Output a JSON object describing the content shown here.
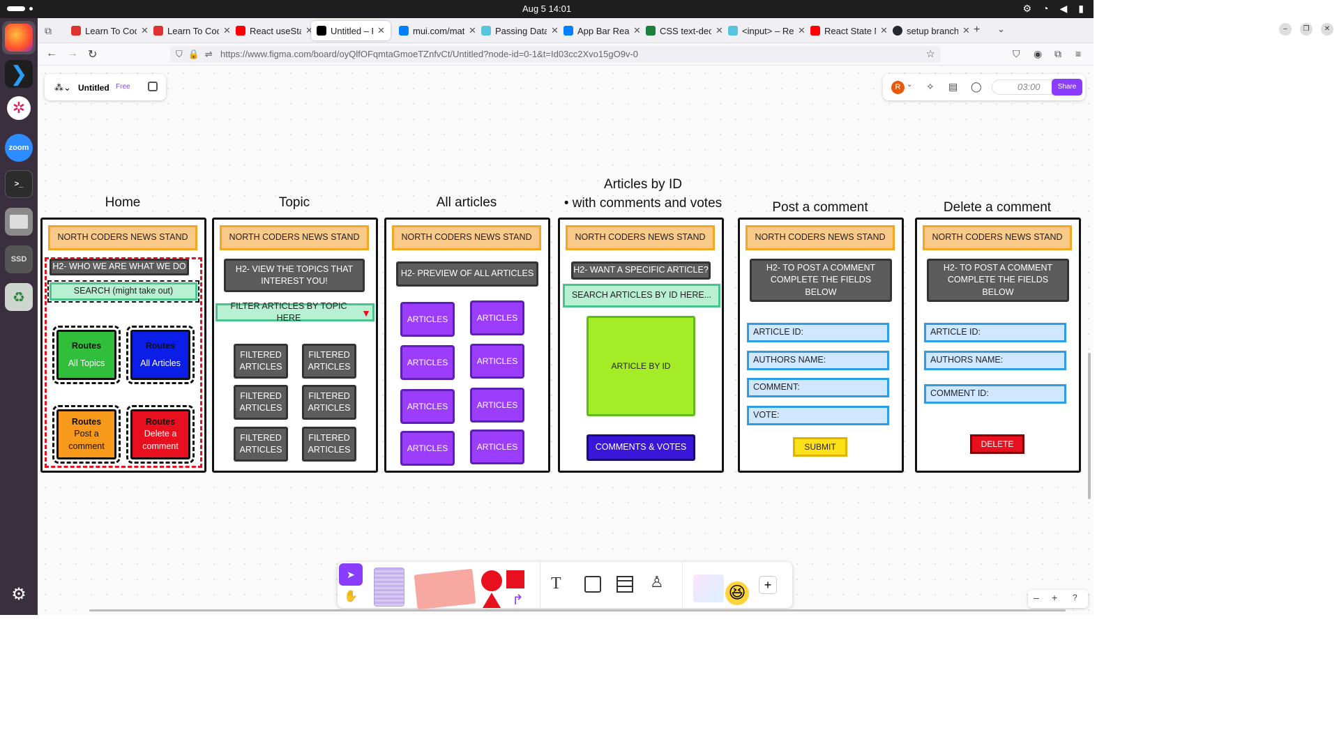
{
  "system": {
    "clock": "Aug 5  14:01",
    "tray_icons": [
      "settings-icon",
      "wifi-icon",
      "volume-icon",
      "battery-icon"
    ]
  },
  "dock": {
    "items": [
      "firefox",
      "vscode",
      "slack",
      "zoom",
      "terminal",
      "files",
      "ssd",
      "trash",
      "ubuntu-apps"
    ],
    "zoom_label": "zoom",
    "ssd_label": "SSD"
  },
  "browser": {
    "tabs": [
      {
        "label": "Learn To Cod",
        "color": "#e03131"
      },
      {
        "label": "Learn To Cod",
        "color": "#e03131"
      },
      {
        "label": "React useSta",
        "color": "#ff0000"
      },
      {
        "label": "Untitled – Fig",
        "color": "#000000",
        "active": true
      },
      {
        "label": "mui.com/mat",
        "color": "#007fff"
      },
      {
        "label": "Passing Data",
        "color": "#58c4dc"
      },
      {
        "label": "App Bar Reac",
        "color": "#007fff"
      },
      {
        "label": "CSS text-dec",
        "color": "#1b7f3b"
      },
      {
        "label": "<input> – Re",
        "color": "#58c4dc"
      },
      {
        "label": "React State M",
        "color": "#ff0000"
      },
      {
        "label": "setup branch",
        "color": "#24292f"
      }
    ],
    "url": "https://www.figma.com/board/oyQlfOFqmtaGmoeTZnfvCt/Untitled?node-id=0-1&t=Id03cc2Xvo15gO9v-0"
  },
  "figma": {
    "file_title": "Untitled",
    "plan_badge": "Free",
    "avatar_initial": "R",
    "timer": "03:00",
    "share_label": "Share"
  },
  "frames": {
    "home": {
      "title": "Home",
      "header": "NORTH CODERS NEWS STAND",
      "h2": "H2- WHO WE ARE WHAT WE DO",
      "search": "SEARCH (might take out)",
      "routes": [
        {
          "title": "Routes",
          "label": "All Topics"
        },
        {
          "title": "Routes",
          "label": "All Articles"
        },
        {
          "title": "Routes",
          "label": "Post a comment"
        },
        {
          "title": "Routes",
          "label": "Delete a comment"
        }
      ]
    },
    "topic": {
      "title": "Topic",
      "header": "NORTH CODERS NEWS STAND",
      "h2": "H2- VIEW THE TOPICS THAT INTEREST YOU!",
      "filter": "FILTER ARTICLES BY TOPIC HERE",
      "items": [
        "FILTERED ARTICLES",
        "FILTERED ARTICLES",
        "FILTERED ARTICLES",
        "FILTERED ARTICLES",
        "FILTERED ARTICLES",
        "FILTERED ARTICLES"
      ]
    },
    "all_articles": {
      "title": "All articles",
      "header": "NORTH CODERS NEWS STAND",
      "h2": "H2- PREVIEW OF ALL ARTICLES",
      "items": [
        "ARTICLES",
        "ARTICLES",
        "ARTICLES",
        "ARTICLES",
        "ARTICLES",
        "ARTICLES",
        "ARTICLES",
        "ARTICLES"
      ]
    },
    "by_id": {
      "title": "Articles by ID",
      "subtitle": "with comments and votes",
      "header": "NORTH CODERS NEWS STAND",
      "h2": "H2- WANT A SPECIFIC ARTICLE?",
      "search": "SEARCH ARTICLES BY ID HERE...",
      "article": "ARTICLE BY ID",
      "comments": "COMMENTS & VOTES"
    },
    "post": {
      "title": "Post a comment",
      "header": "NORTH CODERS NEWS STAND",
      "h2": "H2- TO POST A COMMENT COMPLETE  THE FIELDS BELOW",
      "fields": [
        "ARTICLE ID:",
        "AUTHORS NAME:",
        "COMMENT:",
        "VOTE:"
      ],
      "submit": "SUBMIT"
    },
    "delete": {
      "title": "Delete a comment",
      "header": "NORTH CODERS NEWS STAND",
      "h2": "H2- TO POST A COMMENT COMPLETE  THE FIELDS BELOW",
      "fields": [
        "ARTICLE ID:",
        "AUTHORS NAME:",
        "COMMENT ID:"
      ],
      "delete": "DELETE"
    }
  },
  "toolbar": {
    "tools": [
      "move-tool",
      "hand-tool",
      "section-tool",
      "sticky-note-tool",
      "shapes-tool",
      "connector-tool",
      "text-tool",
      "frame-tool",
      "table-tool",
      "stamp-tool",
      "widgets-tool",
      "add-tool"
    ]
  },
  "zoom": {
    "minus": "–",
    "plus": "+",
    "help": "?"
  }
}
